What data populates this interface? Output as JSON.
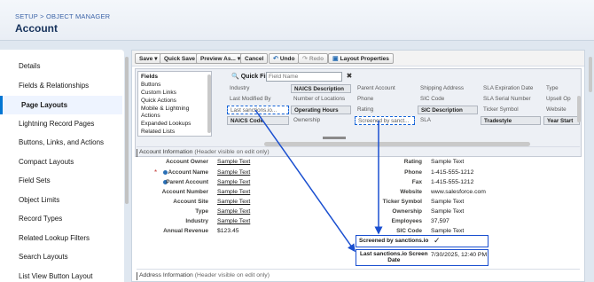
{
  "header": {
    "breadcrumb": "SETUP > OBJECT MANAGER",
    "title": "Account"
  },
  "nav": {
    "items": [
      {
        "label": "Details"
      },
      {
        "label": "Fields & Relationships"
      },
      {
        "label": "Page Layouts"
      },
      {
        "label": "Lightning Record Pages"
      },
      {
        "label": "Buttons, Links, and Actions"
      },
      {
        "label": "Compact Layouts"
      },
      {
        "label": "Field Sets"
      },
      {
        "label": "Object Limits"
      },
      {
        "label": "Record Types"
      },
      {
        "label": "Related Lookup Filters"
      },
      {
        "label": "Search Layouts"
      },
      {
        "label": "List View Button Layout"
      }
    ],
    "active_index": 2
  },
  "toolbar": {
    "save": "Save",
    "quick_save": "Quick Save",
    "preview": "Preview As...",
    "cancel": "Cancel",
    "undo": "Undo",
    "redo": "Redo",
    "layout_properties": "Layout Properties"
  },
  "palette": {
    "categories": [
      "Fields",
      "Buttons",
      "Custom Links",
      "Quick Actions",
      "Mobile & Lightning Actions",
      "Expanded Lookups",
      "Related Lists"
    ],
    "quick_find_label": "Quick Find",
    "quick_find_placeholder": "Field Name",
    "fields": [
      [
        "Industry",
        "NAICS Description",
        "Parent Account",
        "Shipping Address",
        "SLA Expiration Date",
        "Type"
      ],
      [
        "Last Modified By",
        "Number of Locations",
        "Phone",
        "SIC Code",
        "SLA Serial Number",
        "Upsell Op"
      ],
      [
        "Last sanctions.io...",
        "Operating Hours",
        "Rating",
        "SIC Description",
        "Ticker Symbol",
        "Website"
      ],
      [
        "NAICS Code",
        "Ownership",
        "Screened by sanct...",
        "SLA",
        "Tradestyle",
        "Year Start"
      ]
    ]
  },
  "section": {
    "title": "Account Information",
    "hint": "(Header visible on edit only)",
    "second_title": "Address Information",
    "second_hint": "(Header visible on edit only)"
  },
  "left_fields": [
    {
      "label": "Account Owner",
      "value": "Sample Text"
    },
    {
      "label": "Account Name",
      "value": "Sample Text"
    },
    {
      "label": "Parent Account",
      "value": "Sample Text"
    },
    {
      "label": "Account Number",
      "value": "Sample Text"
    },
    {
      "label": "Account Site",
      "value": "Sample Text"
    },
    {
      "label": "Type",
      "value": "Sample Text"
    },
    {
      "label": "Industry",
      "value": "Sample Text"
    },
    {
      "label": "Annual Revenue",
      "value": "$123.45"
    }
  ],
  "right_fields": [
    {
      "label": "Rating",
      "value": "Sample Text"
    },
    {
      "label": "Phone",
      "value": "1-415-555-1212"
    },
    {
      "label": "Fax",
      "value": "1-415-555-1212"
    },
    {
      "label": "Website",
      "value": "www.salesforce.com"
    },
    {
      "label": "Ticker Symbol",
      "value": "Sample Text"
    },
    {
      "label": "Ownership",
      "value": "Sample Text"
    },
    {
      "label": "Employees",
      "value": "37,597"
    },
    {
      "label": "SIC Code",
      "value": "Sample Text"
    }
  ],
  "highlighted_fields": {
    "screened_label": "Screened by sanctions.io",
    "screened_value": "✓",
    "last_label_1": "Last sanctions.io Screen",
    "last_label_2": "Date",
    "last_value": "7/30/2025, 12:40 PM"
  },
  "colors": {
    "accent": "#0176d3",
    "highlight": "#1a4fd0",
    "title": "#16325c"
  }
}
